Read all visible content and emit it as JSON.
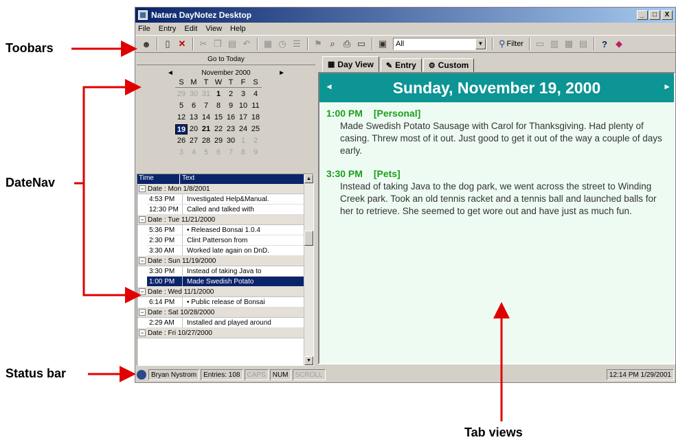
{
  "annotations": {
    "toolbars": "Toobars",
    "datenav": "DateNav",
    "status_bar": "Status bar",
    "tab_views": "Tab views"
  },
  "window": {
    "title": "Natara DayNotez Desktop",
    "controls": [
      "_",
      "□",
      "X"
    ]
  },
  "menu": [
    "File",
    "Entry",
    "Edit",
    "View",
    "Help"
  ],
  "toolbar": {
    "category_select": "All",
    "filter_label": "Filter"
  },
  "date_nav": {
    "go_to_today": "Go to Today",
    "month_label": "November 2000",
    "prev_arrow": "◄",
    "next_arrow": "►",
    "weekdays": [
      "S",
      "M",
      "T",
      "W",
      "T",
      "F",
      "S"
    ],
    "weeks": [
      [
        "29",
        "30",
        "31",
        "1",
        "2",
        "3",
        "4"
      ],
      [
        "5",
        "6",
        "7",
        "8",
        "9",
        "10",
        "11"
      ],
      [
        "12",
        "13",
        "14",
        "15",
        "16",
        "17",
        "18"
      ],
      [
        "19",
        "20",
        "21",
        "22",
        "23",
        "24",
        "25"
      ],
      [
        "26",
        "27",
        "28",
        "29",
        "30",
        "1",
        "2"
      ],
      [
        "3",
        "4",
        "5",
        "6",
        "7",
        "8",
        "9"
      ]
    ],
    "selected_day": "19"
  },
  "entry_list": {
    "columns": [
      "Time",
      "Text"
    ],
    "groups": [
      {
        "label": "Date : Mon 1/8/2001",
        "rows": [
          {
            "time": "4:53 PM",
            "text": "Investigated Help&Manual."
          },
          {
            "time": "12:30 PM",
            "text": "Called and talked with"
          }
        ]
      },
      {
        "label": "Date : Tue 11/21/2000",
        "rows": [
          {
            "time": "5:36 PM",
            "text": "• Released Bonsai 1.0.4"
          },
          {
            "time": "2:30 PM",
            "text": "Clint Patterson from"
          },
          {
            "time": "3:30 AM",
            "text": "Worked late again on DnD."
          }
        ]
      },
      {
        "label": "Date : Sun 11/19/2000",
        "rows": [
          {
            "time": "3:30 PM",
            "text": "Instead of taking Java to"
          },
          {
            "time": "1:00 PM",
            "text": "Made Swedish Potato",
            "selected": true
          }
        ]
      },
      {
        "label": "Date : Wed 11/1/2000",
        "rows": [
          {
            "time": "6:14 PM",
            "text": "• Public release of Bonsai"
          }
        ]
      },
      {
        "label": "Date : Sat 10/28/2000",
        "rows": [
          {
            "time": "2:29 AM",
            "text": "Installed and played around"
          }
        ]
      },
      {
        "label": "Date : Fri 10/27/2000",
        "rows": []
      }
    ]
  },
  "tabs": [
    {
      "label": "Day View",
      "active": true
    },
    {
      "label": "Entry",
      "active": false
    },
    {
      "label": "Custom",
      "active": false
    }
  ],
  "day_view": {
    "heading": "Sunday, November 19, 2000",
    "entries": [
      {
        "time": "1:00 PM",
        "category": "[Personal]",
        "text": "Made Swedish Potato Sausage with Carol for Thanksgiving. Had plenty of casing. Threw most of it out. Just good to get it out of the way a couple of days early."
      },
      {
        "time": "3:30 PM",
        "category": "[Pets]",
        "text": "Instead of taking Java to the dog park, we went across the street to Winding Creek park. Took an old tennis racket and a tennis ball and launched balls for her to retrieve. She seemed to get wore out and have just as much fun."
      }
    ]
  },
  "status_bar": {
    "user": "Bryan Nystrom",
    "entries": "Entries: 108",
    "caps": "CAPS",
    "num": "NUM",
    "scroll": "SCROLL",
    "datetime": "12:14 PM 1/29/2001"
  },
  "colors": {
    "annotation_arrow": "#e00000",
    "title_bar": "#0a246a",
    "day_header": "#0d9494",
    "entry_heading": "#1aa01a",
    "day_view_bg": "#eefbf3"
  }
}
